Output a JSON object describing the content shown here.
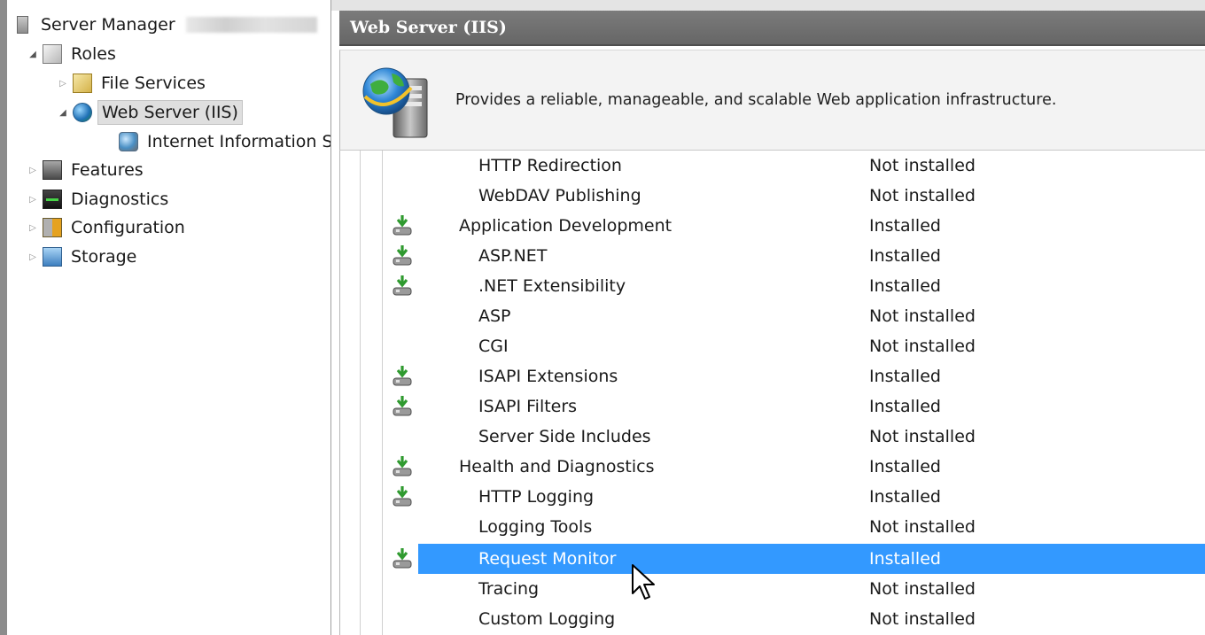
{
  "tree": {
    "root_label": "Server Manager",
    "items": [
      {
        "label": "Roles",
        "icon": "roles-icon"
      },
      {
        "label": "File Services",
        "icon": "file-services-icon"
      },
      {
        "label": "Web Server (IIS)",
        "icon": "web-server-icon"
      },
      {
        "label": "Internet Information S",
        "icon": "iis-manager-icon"
      },
      {
        "label": "Features",
        "icon": "features-icon"
      },
      {
        "label": "Diagnostics",
        "icon": "diagnostics-icon"
      },
      {
        "label": "Configuration",
        "icon": "configuration-icon"
      },
      {
        "label": "Storage",
        "icon": "storage-icon"
      }
    ]
  },
  "header": {
    "title": "Web Server (IIS)"
  },
  "description": {
    "text": "Provides a reliable, manageable, and scalable Web application infrastructure."
  },
  "services": [
    {
      "name": "HTTP Redirection",
      "status": "Not installed"
    },
    {
      "name": "WebDAV Publishing",
      "status": "Not installed"
    },
    {
      "name": "Application Development",
      "status": "Installed"
    },
    {
      "name": "ASP.NET",
      "status": "Installed"
    },
    {
      "name": ".NET Extensibility",
      "status": "Installed"
    },
    {
      "name": "ASP",
      "status": "Not installed"
    },
    {
      "name": "CGI",
      "status": "Not installed"
    },
    {
      "name": "ISAPI Extensions",
      "status": "Installed"
    },
    {
      "name": "ISAPI Filters",
      "status": "Installed"
    },
    {
      "name": "Server Side Includes",
      "status": "Not installed"
    },
    {
      "name": "Health and Diagnostics",
      "status": "Installed"
    },
    {
      "name": "HTTP Logging",
      "status": "Installed"
    },
    {
      "name": "Logging Tools",
      "status": "Not installed"
    },
    {
      "name": "Request Monitor",
      "status": "Installed"
    },
    {
      "name": "Tracing",
      "status": "Not installed"
    },
    {
      "name": "Custom Logging",
      "status": "Not installed"
    }
  ],
  "colors": {
    "selection": "#3399ff",
    "header_bar": "#6e6e6e",
    "installed_icon_arrow": "#3aa83a"
  }
}
